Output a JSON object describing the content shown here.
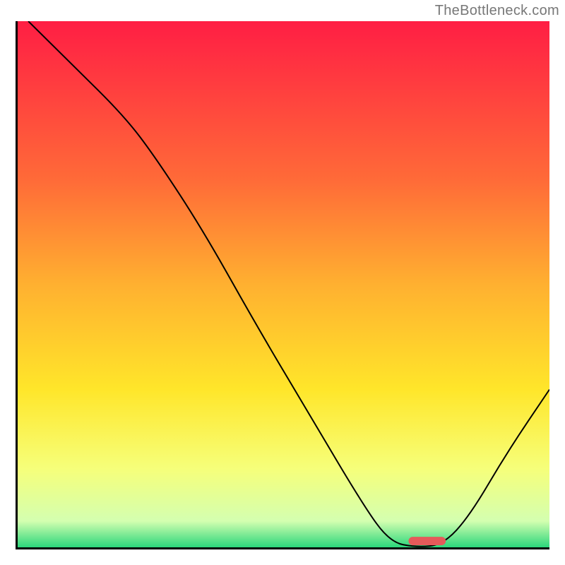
{
  "watermark": "TheBottleneck.com",
  "chart_data": {
    "type": "line",
    "title": "",
    "xlabel": "",
    "ylabel": "",
    "xlim": [
      0,
      100
    ],
    "ylim": [
      0,
      100
    ],
    "grid": false,
    "legend": false,
    "background_gradient": {
      "stops": [
        {
          "offset": 0.0,
          "color": "#ff1e44"
        },
        {
          "offset": 0.3,
          "color": "#ff6a38"
        },
        {
          "offset": 0.5,
          "color": "#ffb030"
        },
        {
          "offset": 0.7,
          "color": "#ffe62a"
        },
        {
          "offset": 0.85,
          "color": "#f6ff7a"
        },
        {
          "offset": 0.95,
          "color": "#d4ffb0"
        },
        {
          "offset": 1.0,
          "color": "#2bd67b"
        }
      ]
    },
    "curve_points": [
      {
        "x": 2,
        "y": 100
      },
      {
        "x": 10,
        "y": 92
      },
      {
        "x": 20,
        "y": 82
      },
      {
        "x": 26,
        "y": 74
      },
      {
        "x": 35,
        "y": 60
      },
      {
        "x": 45,
        "y": 42
      },
      {
        "x": 55,
        "y": 25
      },
      {
        "x": 65,
        "y": 8
      },
      {
        "x": 70,
        "y": 1
      },
      {
        "x": 75,
        "y": 0
      },
      {
        "x": 80,
        "y": 0.5
      },
      {
        "x": 85,
        "y": 6
      },
      {
        "x": 92,
        "y": 18
      },
      {
        "x": 100,
        "y": 30
      }
    ],
    "marker_bar": {
      "x_start": 73.5,
      "x_end": 80.5,
      "y": 1.2,
      "color": "#e55a5a",
      "thickness_pct": 1.6
    }
  }
}
